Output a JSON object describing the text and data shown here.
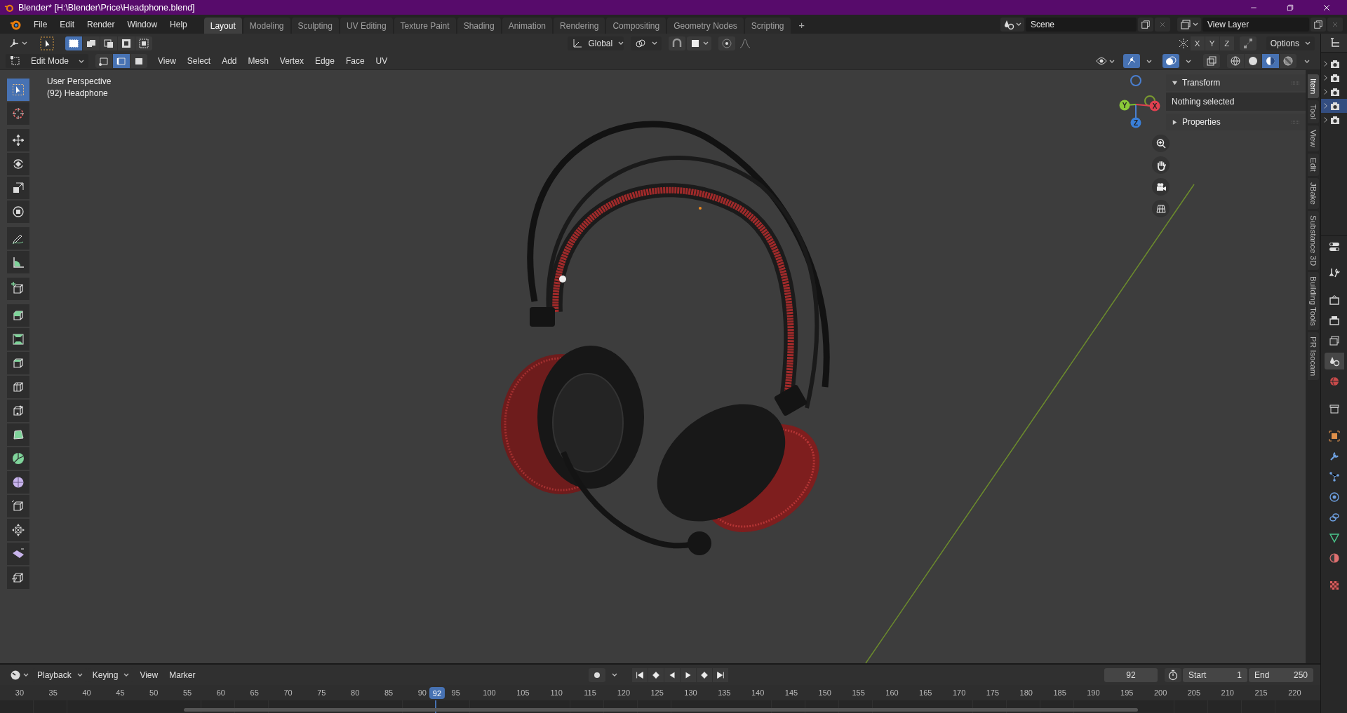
{
  "window": {
    "title": "Blender* [H:\\Blender\\Price\\Headphone.blend]"
  },
  "menu": [
    "File",
    "Edit",
    "Render",
    "Window",
    "Help"
  ],
  "workspaces": [
    {
      "label": "Layout",
      "selected": true
    },
    {
      "label": "Modeling",
      "selected": false
    },
    {
      "label": "Sculpting",
      "selected": false
    },
    {
      "label": "UV Editing",
      "selected": false
    },
    {
      "label": "Texture Paint",
      "selected": false
    },
    {
      "label": "Shading",
      "selected": false
    },
    {
      "label": "Animation",
      "selected": false
    },
    {
      "label": "Rendering",
      "selected": false
    },
    {
      "label": "Compositing",
      "selected": false
    },
    {
      "label": "Geometry Nodes",
      "selected": false
    },
    {
      "label": "Scripting",
      "selected": false
    }
  ],
  "add_workspace": "+",
  "scene": {
    "value": "Scene"
  },
  "view_layer": {
    "value": "View Layer"
  },
  "tool_header": {
    "select_modes": [
      {
        "selected": true
      },
      {
        "selected": false
      },
      {
        "selected": false
      },
      {
        "selected": false
      },
      {
        "selected": false
      }
    ],
    "orientation": "Global",
    "mirror_axes": [
      {
        "label": "X",
        "on": false
      },
      {
        "label": "Y",
        "on": false
      },
      {
        "label": "Z",
        "on": false
      }
    ],
    "options": "Options"
  },
  "view_header": {
    "mode": "Edit Mode",
    "mesh_select_modes": [
      {
        "selected": false
      },
      {
        "selected": true
      },
      {
        "selected": false
      }
    ],
    "menus": [
      "View",
      "Select",
      "Add",
      "Mesh",
      "Vertex",
      "Edge",
      "Face",
      "UV"
    ],
    "gizmos_on": true,
    "overlays_on": true,
    "xray_on": false,
    "shading_modes": [
      {
        "selected": false
      },
      {
        "selected": false
      },
      {
        "selected": true
      },
      {
        "selected": false
      }
    ]
  },
  "toolbar": {
    "tools": [
      {
        "selected": true
      },
      {
        "selected": false
      },
      {
        "selected": false
      },
      {
        "selected": false
      },
      {
        "selected": false
      },
      {
        "selected": false
      },
      {
        "selected": false
      },
      {
        "selected": false
      },
      {
        "selected": false
      },
      {
        "selected": false
      },
      {
        "selected": false
      },
      {
        "selected": false
      },
      {
        "selected": false
      },
      {
        "selected": false
      },
      {
        "selected": false
      },
      {
        "selected": false
      },
      {
        "selected": false
      },
      {
        "selected": false
      },
      {
        "selected": false
      },
      {
        "selected": false
      },
      {
        "selected": false
      }
    ]
  },
  "viewport": {
    "info": [
      "User Perspective",
      "(92) Headphone"
    ],
    "gizmo_axes": [
      "X",
      "Y",
      "Z"
    ]
  },
  "sidebar": {
    "panels": [
      {
        "title": "Transform",
        "expanded": true,
        "body": "Nothing selected"
      },
      {
        "title": "Properties",
        "expanded": false
      }
    ],
    "tabs": [
      {
        "label": "Item",
        "selected": true
      },
      {
        "label": "Tool",
        "selected": false
      },
      {
        "label": "View",
        "selected": false
      },
      {
        "label": "Edit",
        "selected": false
      },
      {
        "label": "JBake",
        "selected": false
      },
      {
        "label": "Substance 3D",
        "selected": false
      },
      {
        "label": "Building Tools",
        "selected": false
      },
      {
        "label": "PR Isocam",
        "selected": false
      }
    ]
  },
  "outliner": {
    "rows": [
      {
        "selected": false
      },
      {
        "selected": false
      },
      {
        "selected": false
      },
      {
        "selected": true
      },
      {
        "selected": false
      }
    ]
  },
  "properties_tabs": [
    {
      "selected": false
    },
    {
      "selected": false
    },
    {
      "selected": false
    },
    {
      "selected": false
    },
    {
      "selected": true
    },
    {
      "selected": false
    },
    {
      "selected": false
    },
    {
      "selected": false
    },
    {
      "selected": false
    },
    {
      "selected": false
    },
    {
      "selected": false
    },
    {
      "selected": false
    },
    {
      "selected": false
    },
    {
      "selected": false
    },
    {
      "selected": false
    }
  ],
  "timeline": {
    "menus": [
      {
        "label": "Playback",
        "kind": "dropdown"
      },
      {
        "label": "Keying",
        "kind": "dropdown"
      },
      {
        "label": "View",
        "kind": "menu"
      },
      {
        "label": "Marker",
        "kind": "menu"
      }
    ],
    "auto_keying": false,
    "current_frame": "92",
    "start_label": "Start",
    "start": "1",
    "end_label": "End",
    "end": "250",
    "ruler": [
      "30",
      "35",
      "40",
      "45",
      "50",
      "55",
      "60",
      "65",
      "70",
      "75",
      "80",
      "85",
      "90",
      "95",
      "100",
      "105",
      "110",
      "115",
      "120",
      "125",
      "130",
      "135",
      "140",
      "145",
      "150",
      "155",
      "160",
      "165",
      "170",
      "175",
      "180",
      "185",
      "190",
      "195",
      "200",
      "205",
      "210",
      "215",
      "220"
    ],
    "playhead": "92"
  }
}
